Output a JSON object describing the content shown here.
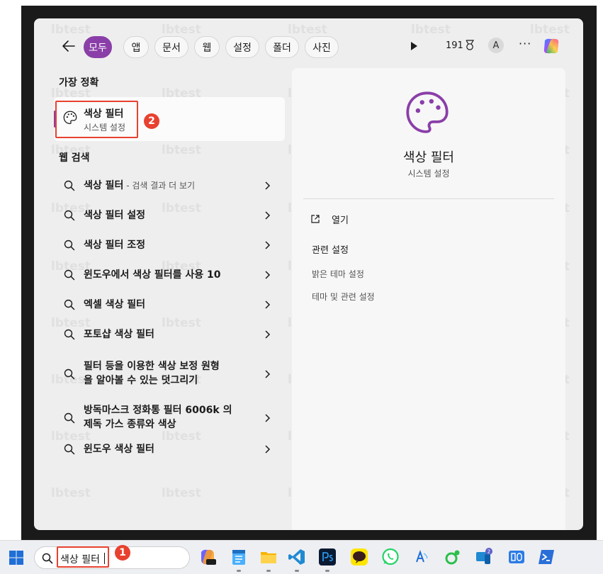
{
  "topbar": {
    "filters": [
      "모두",
      "앱",
      "문서",
      "웹",
      "설정",
      "폴더",
      "사진"
    ],
    "active_filter": "모두",
    "points": "191",
    "avatar_letter": "A",
    "more": "···"
  },
  "best_match": {
    "section_label": "가장 정확",
    "title": "색상 필터",
    "subtitle": "시스템 설정",
    "badge": "2"
  },
  "web_search": {
    "section_label": "웹 검색",
    "rows": [
      {
        "line1": "색상 필터",
        "suffix": " - 검색 결과 더 보기",
        "line2": ""
      },
      {
        "line1": "색상 필터 설정",
        "suffix": "",
        "line2": ""
      },
      {
        "line1": "색상 필터 조정",
        "suffix": "",
        "line2": ""
      },
      {
        "line1": "윈도우에서 색상 필터를 사용 10",
        "suffix": "",
        "line2": ""
      },
      {
        "line1": "엑셀 색상 필터",
        "suffix": "",
        "line2": ""
      },
      {
        "line1": "포토샵 색상 필터",
        "suffix": "",
        "line2": ""
      },
      {
        "line1": "필터 등을 이용한 색상 보정 원형",
        "suffix": "",
        "line2": "을 알아볼 수 있는 덧그리기"
      },
      {
        "line1": "방독마스크 정화통 필터 6006k 의",
        "suffix": "",
        "line2": "제독 가스 종류와 색상"
      },
      {
        "line1": "윈도우 색상 필터",
        "suffix": "",
        "line2": ""
      }
    ]
  },
  "preview": {
    "title": "색상 필터",
    "subtitle": "시스템 설정",
    "open_label": "열기",
    "related_heading": "관련 설정",
    "related_links": [
      "밝은 테마 설정",
      "테마 및 관련 설정"
    ]
  },
  "taskbar": {
    "search_value": "색상 필터",
    "badge": "1",
    "notification_count": "2"
  },
  "watermark": "lbtest",
  "colors": {
    "accent": "#8a3ea8",
    "annotation_red": "#e8412f"
  }
}
